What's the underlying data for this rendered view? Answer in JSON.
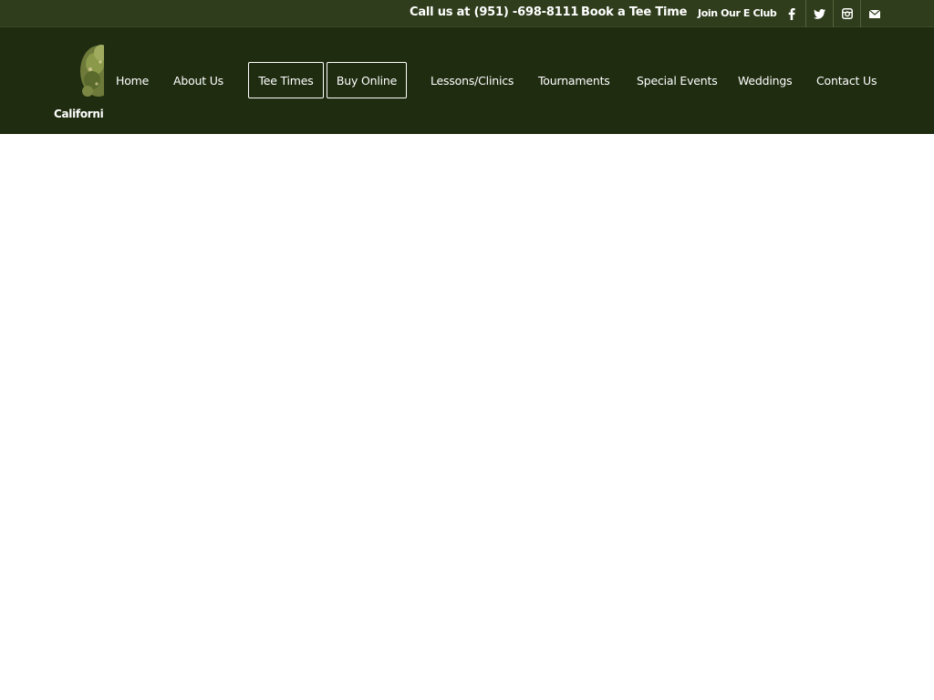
{
  "topbar": {
    "phone_text": "Call us at (951) -698-8111",
    "book_text": "Book a Tee Time",
    "eclub_text": "Join Our E Club",
    "social": [
      {
        "icon": "facebook-icon"
      },
      {
        "icon": "twitter-icon"
      },
      {
        "icon": "instagram-icon"
      },
      {
        "icon": "mail-icon"
      }
    ]
  },
  "logo": {
    "text": "Californi"
  },
  "nav": {
    "home": "Home",
    "about": "About Us",
    "tee_times": "Tee Times",
    "buy_online": "Buy Online",
    "lessons": "Lessons/Clinics",
    "tournaments": "Tournaments",
    "special_events": "Special Events",
    "weddings": "Weddings",
    "contact": "Contact Us"
  },
  "colors": {
    "topbar_bg": "#2f3d1c",
    "mainbar_bg": "#1f2c10",
    "text": "#ffffff"
  }
}
